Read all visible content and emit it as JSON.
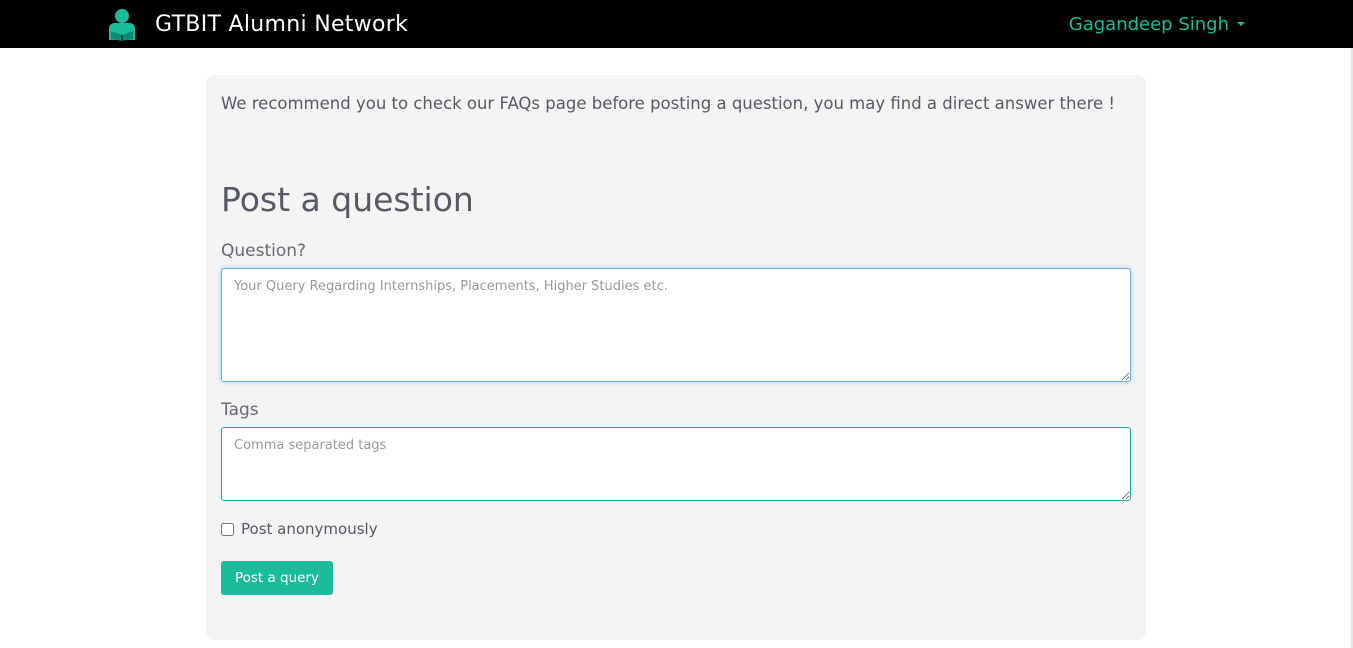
{
  "navbar": {
    "brand_icon": "graduate-reading-icon",
    "brand_title": "GTBIT Alumni Network",
    "user_name": "Gagandeep Singh",
    "user_menu_icon": "caret-down-icon"
  },
  "form": {
    "notice": "We recommend you to check our FAQs page before posting a question, you may find a direct answer there !",
    "heading": "Post a question",
    "question_label": "Question?",
    "question_placeholder": "Your Query Regarding Internships, Placements, Higher Studies etc.",
    "question_value": "",
    "tags_label": "Tags",
    "tags_placeholder": "Comma separated tags",
    "tags_value": "",
    "anonymous_label": "Post anonymously",
    "anonymous_checked": false,
    "submit_label": "Post a query"
  },
  "colors": {
    "accent": "#1abc9c",
    "navbar_bg": "#000000",
    "card_bg": "#f4f4f4",
    "focus_border": "#66afe9"
  }
}
